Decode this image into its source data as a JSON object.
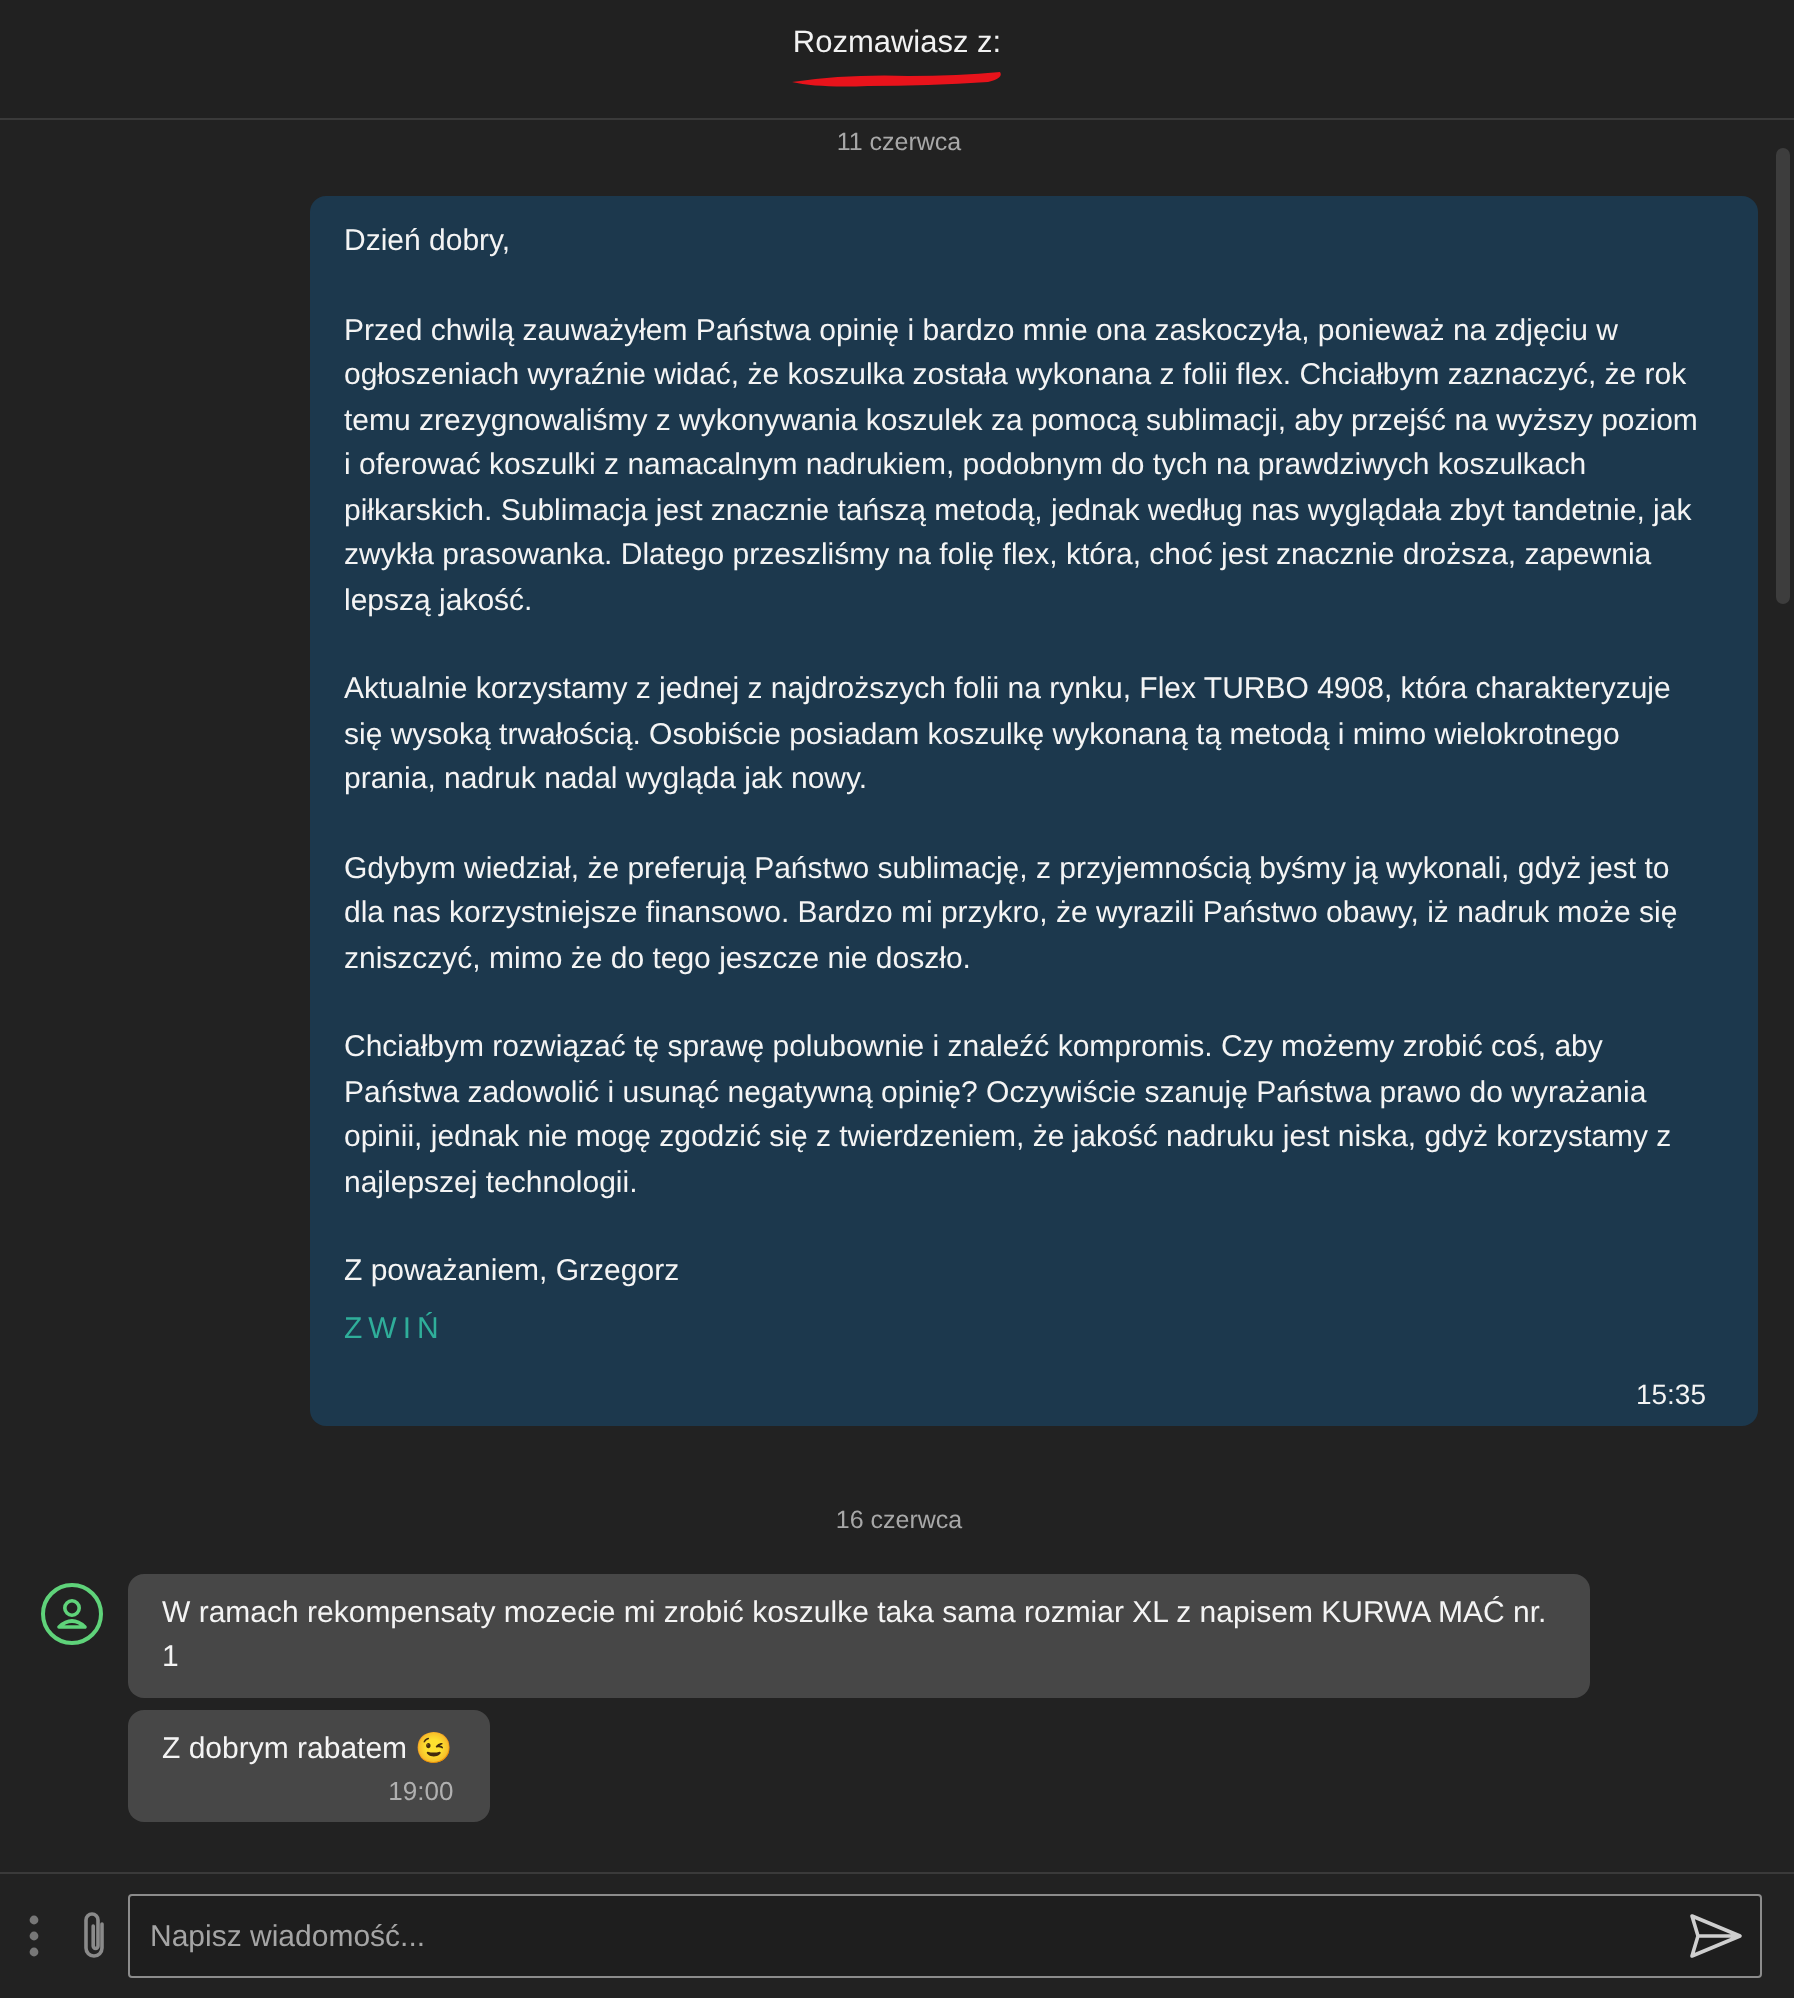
{
  "header": {
    "title": "Rozmawiasz z:",
    "redacted": true
  },
  "days": [
    {
      "date": "11 czerwca",
      "messages": [
        {
          "kind": "outgoing",
          "paragraphs": [
            "Dzień dobry,",
            "Przed chwilą zauważyłem Państwa opinię i bardzo mnie ona zaskoczyła, ponieważ na zdjęciu w ogłoszeniach wyraźnie widać, że koszulka została wykonana z folii flex. Chciałbym zaznaczyć, że rok temu zrezygnowaliśmy z wykonywania koszulek za pomocą sublimacji, aby przejść na wyższy poziom i oferować koszulki z namacalnym nadrukiem, podobnym do tych na prawdziwych koszulkach piłkarskich. Sublimacja jest znacznie tańszą metodą, jednak według nas wyglądała zbyt tandetnie, jak zwykła prasowanka. Dlatego przeszliśmy na folię flex, która, choć jest znacznie droższa, zapewnia lepszą jakość.",
            "Aktualnie korzystamy z jednej z najdroższych folii na rynku, Flex TURBO 4908, która charakteryzuje się wysoką trwałością. Osobiście posiadam koszulkę wykonaną tą metodą i mimo wielokrotnego prania, nadruk nadal wygląda jak nowy.",
            "Gdybym wiedział, że preferują Państwo sublimację, z przyjemnością byśmy ją wykonali, gdyż jest to dla nas korzystniejsze finansowo. Bardzo mi przykro, że wyrazili Państwo obawy, iż nadruk może się zniszczyć, mimo że do tego jeszcze nie doszło.",
            "Chciałbym rozwiązać tę sprawę polubownie i znaleźć kompromis. Czy możemy zrobić coś, aby Państwa zadowolić i usunąć negatywną opinię? Oczywiście szanuję Państwa prawo do wyrażania opinii, jednak nie mogę zgodzić się z twierdzeniem, że jakość nadruku jest niska, gdyż korzystamy z najlepszej technologii.",
            "Z poważaniem, Grzegorz"
          ],
          "toggle": "ZWIŃ",
          "time": "15:35"
        }
      ]
    },
    {
      "date": "16 czerwca",
      "messages": [
        {
          "kind": "incoming",
          "avatar": true,
          "paragraphs": [
            "W ramach rekompensaty mozecie mi zrobić koszulke taka sama rozmiar XL z napisem KURWA MAĆ nr. 1"
          ]
        },
        {
          "kind": "incoming",
          "avatar": false,
          "paragraphs": [
            "Z dobrym rabatem 😉"
          ],
          "time": "19:00"
        }
      ]
    }
  ],
  "composer": {
    "placeholder": "Napisz wiadomość..."
  }
}
